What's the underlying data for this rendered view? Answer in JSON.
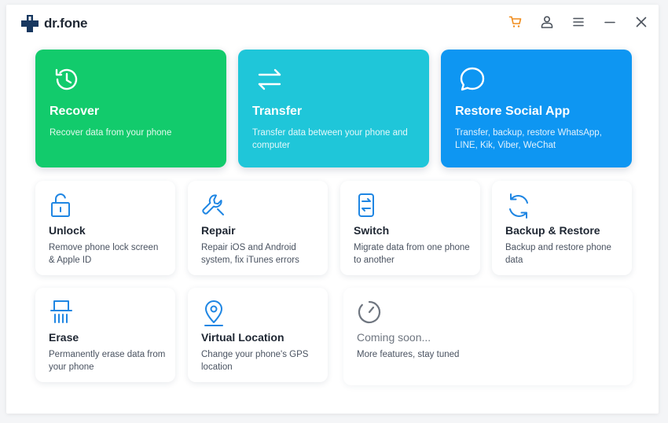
{
  "app": {
    "name": "dr.fone"
  },
  "colors": {
    "recover": "#12cb6c",
    "transfer": "#1fc6d9",
    "social": "#0e96f2",
    "icon_blue": "#1f86e3",
    "cart": "#f08c1b"
  },
  "window_controls": {
    "icons": [
      "cart-icon",
      "user-icon",
      "menu-icon",
      "minimize-icon",
      "close-icon"
    ]
  },
  "big_cards": [
    {
      "title": "Recover",
      "desc": "Recover data from your phone",
      "icon": "history-icon"
    },
    {
      "title": "Transfer",
      "desc": "Transfer data between your phone and computer",
      "icon": "transfer-arrows-icon"
    },
    {
      "title": "Restore Social App",
      "desc": "Transfer, backup, restore WhatsApp, LINE, Kik, Viber, WeChat",
      "icon": "chat-bubble-icon"
    }
  ],
  "small_cards": [
    {
      "title": "Unlock",
      "desc": "Remove phone lock screen & Apple ID",
      "icon": "unlock-icon"
    },
    {
      "title": "Repair",
      "desc": "Repair iOS and Android system, fix iTunes errors",
      "icon": "wrench-icon"
    },
    {
      "title": "Switch",
      "desc": "Migrate data from one phone to another",
      "icon": "phone-switch-icon"
    },
    {
      "title": "Backup & Restore",
      "desc": "Backup and restore phone data",
      "icon": "sync-icon"
    },
    {
      "title": "Erase",
      "desc": "Permanently erase data from your phone",
      "icon": "shredder-icon"
    },
    {
      "title": "Virtual Location",
      "desc": "Change your phone's GPS location",
      "icon": "location-pin-icon"
    }
  ],
  "coming_soon": {
    "title": "Coming soon...",
    "desc": "More features, stay tuned",
    "icon": "timer-icon"
  }
}
